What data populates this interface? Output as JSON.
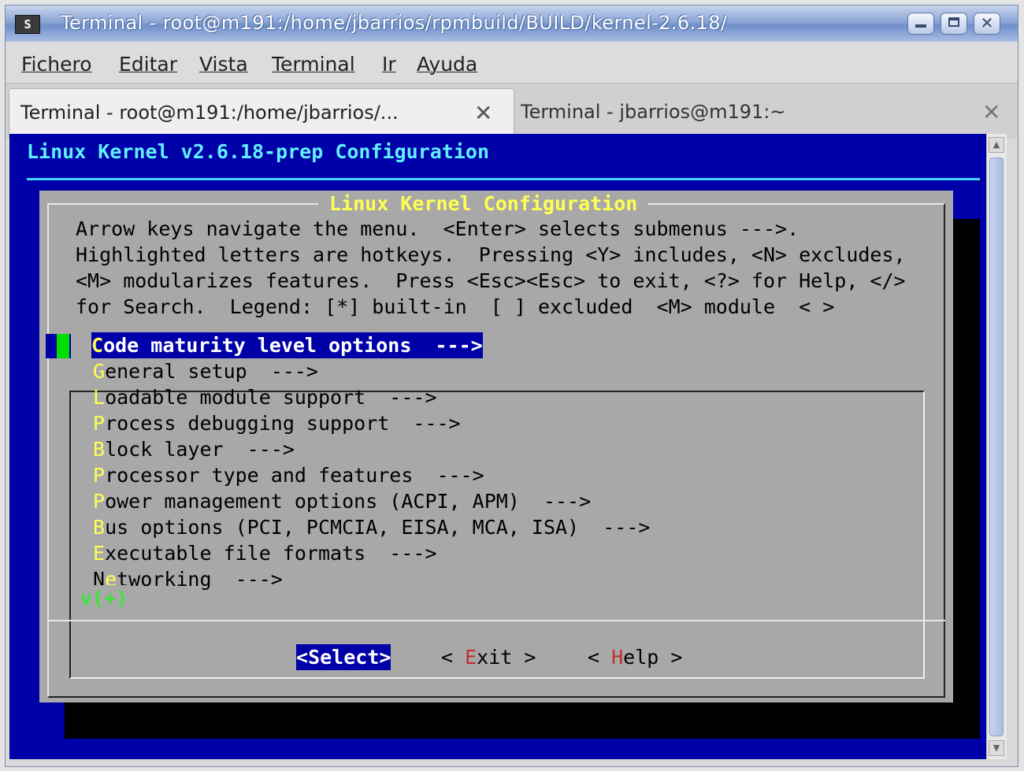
{
  "window": {
    "title": "Terminal - root@m191:/home/jbarrios/rpmbuild/BUILD/kernel-2.6.18/",
    "app_icon": "S"
  },
  "menubar": [
    "Fichero",
    "Editar",
    "Vista",
    "Terminal",
    "Ir",
    "Ayuda"
  ],
  "tabs": [
    {
      "label": "Terminal - root@m191:/home/jbarrios/...",
      "close_icon": "✕"
    },
    {
      "label": "Terminal - jbarrios@m191:~",
      "close_icon": "✕"
    }
  ],
  "terminal": {
    "header": "Linux Kernel v2.6.18-prep Configuration",
    "dialog_title": "Linux Kernel Configuration",
    "help_lines": [
      "Arrow keys navigate the menu.  <Enter> selects submenus --->.",
      "Highlighted letters are hotkeys.  Pressing <Y> includes, <N> excludes,",
      "<M> modularizes features.  Press <Esc><Esc> to exit, <?> for Help, </>",
      "for Search.  Legend: [*] built-in  [ ] excluded  <M> module  < >"
    ],
    "menu_items": [
      {
        "pre": "",
        "hotkey": "C",
        "rest": "ode maturity level options  --->"
      },
      {
        "pre": "",
        "hotkey": "G",
        "rest": "eneral setup  --->"
      },
      {
        "pre": "",
        "hotkey": "L",
        "rest": "oadable module support  --->"
      },
      {
        "pre": "",
        "hotkey": "P",
        "rest": "rocess debugging support  --->"
      },
      {
        "pre": "",
        "hotkey": "B",
        "rest": "lock layer  --->"
      },
      {
        "pre": "",
        "hotkey": "P",
        "rest": "rocessor type and features  --->"
      },
      {
        "pre": "",
        "hotkey": "P",
        "rest": "ower management options (ACPI, APM)  --->"
      },
      {
        "pre": "",
        "hotkey": "B",
        "rest": "us options (PCI, PCMCIA, EISA, MCA, ISA)  --->"
      },
      {
        "pre": "",
        "hotkey": "E",
        "rest": "xecutable file formats  --->"
      },
      {
        "pre": "N",
        "hotkey": "e",
        "rest": "tworking  --->"
      }
    ],
    "more_indicator": "v(+)",
    "buttons": {
      "select": {
        "open": "<",
        "hotkey": "S",
        "rest": "elect",
        "close": ">"
      },
      "exit": {
        "open": "< ",
        "hotkey": "E",
        "rest": "xit",
        "close": " >"
      },
      "help": {
        "open": "< ",
        "hotkey": "H",
        "rest": "elp",
        "close": " >"
      }
    }
  },
  "colors": {
    "terminal_bg": "#0000a8",
    "dialog_bg": "#a8a8a8",
    "hotkey": "#ffff54",
    "title_cyan": "#5ff0ff",
    "cursor_green": "#00e000"
  }
}
